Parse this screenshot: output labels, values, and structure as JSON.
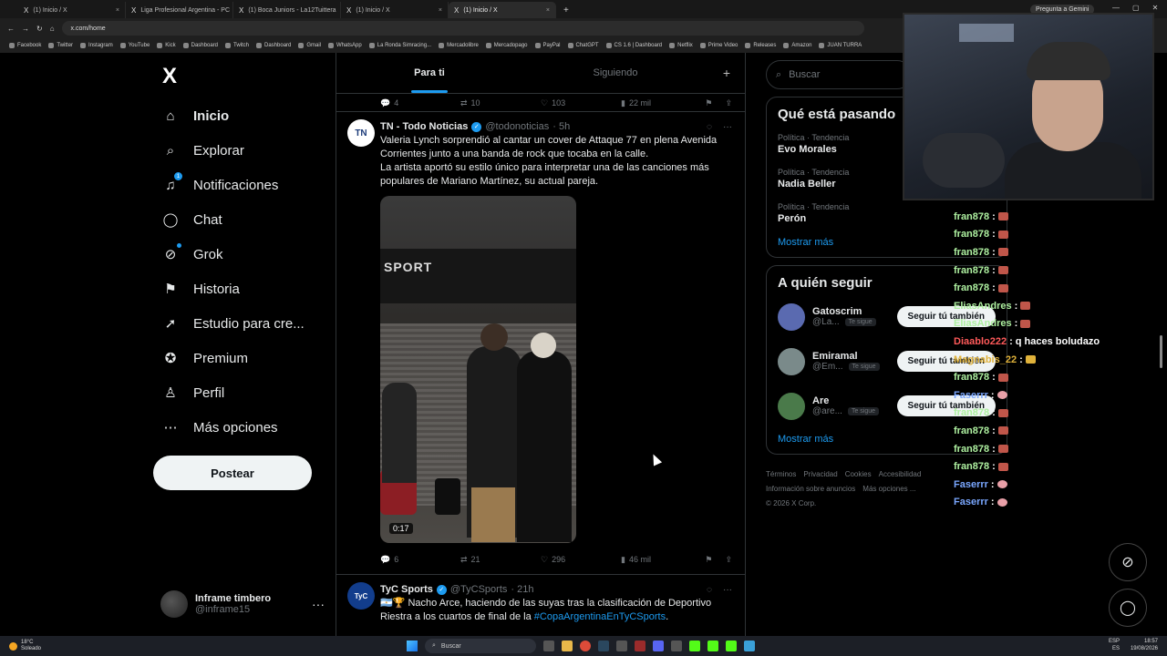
{
  "browser": {
    "tabs": [
      {
        "label": "(1) Inicio / X",
        "icon": "x-icon",
        "active": false
      },
      {
        "label": "Liga Profesional Argentina - PC",
        "icon": "leaf-icon",
        "active": false
      },
      {
        "label": "(1) Boca Juniors - La12Tuittera",
        "icon": "x-icon",
        "active": false
      },
      {
        "label": "(1) Inicio / X",
        "icon": "x-icon",
        "active": false
      },
      {
        "label": "(1) Inicio / X",
        "icon": "x-icon",
        "active": true
      }
    ],
    "new_tab": "+",
    "gemini_label": "Pregunta a Gemini",
    "url": "x.com/home",
    "bookmarks": [
      "Facebook",
      "Twitter",
      "Instagram",
      "YouTube",
      "Kick",
      "Dashboard",
      "Twitch",
      "Dashboard",
      "Gmail",
      "WhatsApp",
      "La Ronda Simracing...",
      "Mercadolibre",
      "Mercadopago",
      "PayPal",
      "ChatGPT",
      "CS 1.6 | Dashboard",
      "Netflix",
      "Prime Video",
      "Releases",
      "Amazon",
      "JUAN TURRA"
    ]
  },
  "nav": {
    "logo": "X",
    "items": [
      {
        "label": "Inicio",
        "icon": "home-icon",
        "active": true
      },
      {
        "label": "Explorar",
        "icon": "search-icon"
      },
      {
        "label": "Notificaciones",
        "icon": "bell-icon",
        "badge": "1"
      },
      {
        "label": "Chat",
        "icon": "chat-icon"
      },
      {
        "label": "Grok",
        "icon": "grok-icon"
      },
      {
        "label": "Historia",
        "icon": "bookmark-icon"
      },
      {
        "label": "Estudio para cre...",
        "icon": "rocket-icon"
      },
      {
        "label": "Premium",
        "icon": "verified-icon"
      },
      {
        "label": "Perfil",
        "icon": "person-icon"
      },
      {
        "label": "Más opciones",
        "icon": "more-icon"
      }
    ],
    "post_button": "Postear",
    "account": {
      "name": "Inframe timbero",
      "handle": "@inframe15",
      "more": "···"
    }
  },
  "feed": {
    "tabs": [
      "Para ti",
      "Siguiendo"
    ],
    "add": "+",
    "prev_actions": {
      "replies": "4",
      "reposts": "10",
      "likes": "103",
      "views": "22 mil"
    },
    "tweet1": {
      "avatar_text": "TN",
      "name": "TN - Todo Noticias",
      "handle": "@todonoticias",
      "time": "· 5h",
      "text1": "Valeria Lynch sorprendió al cantar un cover de Attaque 77 en plena Avenida Corrientes junto a una banda de rock que tocaba en la calle.",
      "text2": "La artista aportó su estilo único para interpretar una de las canciones más populares de Mariano Martínez, su actual pareja.",
      "video_sign": "SPORT",
      "duration": "0:17",
      "actions": {
        "replies": "6",
        "reposts": "21",
        "likes": "296",
        "views": "46 mil"
      }
    },
    "tweet2": {
      "avatar_text": "TyC",
      "name": "TyC Sports",
      "handle": "@TyCSports",
      "time": "· 21h",
      "text": "🇦🇷🏆 Nacho Arce, haciendo de las suyas tras la clasificación de Deportivo Riestra a los cuartos de final de la",
      "hashtag": "#CopaArgentinaEnTyCSports",
      "tail": "."
    }
  },
  "sidebar": {
    "search_placeholder": "Buscar",
    "trends_title": "Qué está pasando",
    "trends": [
      {
        "category": "Política · Tendencia",
        "name": "Evo Morales"
      },
      {
        "category": "Política · Tendencia",
        "name": "Nadia Beller"
      },
      {
        "category": "Política · Tendencia",
        "name": "Perón"
      }
    ],
    "show_more": "Mostrar más",
    "follow_title": "A quién seguir",
    "follow": [
      {
        "name": "Gatoscrim",
        "handle": "@La...",
        "tag": "Te sigue",
        "button": "Seguir tú también"
      },
      {
        "name": "Emiramal",
        "handle": "@Em...",
        "tag": "Te sigue",
        "button": "Seguir tú también"
      },
      {
        "name": "Are",
        "handle": "@are...",
        "tag": "Te sigue",
        "button": "Seguir tú también"
      }
    ],
    "show_more2": "Mostrar más",
    "footer": [
      "Términos",
      "Privacidad",
      "Cookies",
      "Accesibilidad",
      "Información sobre anuncios",
      "Más opciones ...",
      "© 2026 X Corp."
    ]
  },
  "chat": [
    {
      "user": "fran878",
      "msg": "",
      "emote": "r"
    },
    {
      "user": "fran878",
      "msg": "",
      "emote": "r"
    },
    {
      "user": "fran878",
      "msg": "",
      "emote": "r"
    },
    {
      "user": "fran878",
      "msg": "",
      "emote": "r"
    },
    {
      "user": "fran878",
      "msg": "",
      "emote": "r"
    },
    {
      "user": "EliasAndres",
      "msg": "",
      "emote": "r",
      "color": "#aef0a0"
    },
    {
      "user": "EliasAndres",
      "msg": "",
      "emote": "r",
      "color": "#aef0a0"
    },
    {
      "user": "Diaablo222",
      "msg": "q haces boludazo",
      "emote": "",
      "color": "#ff5a5a"
    },
    {
      "user": "Magnabis_22",
      "msg": "",
      "emote": "y",
      "color": "#e0b23a"
    },
    {
      "user": "fran878",
      "msg": "",
      "emote": "r"
    },
    {
      "user": "Faserrr",
      "msg": "",
      "emote": "p",
      "color": "#7aa7ff"
    },
    {
      "user": "fran878",
      "msg": "",
      "emote": "r"
    },
    {
      "user": "fran878",
      "msg": "",
      "emote": "r"
    },
    {
      "user": "fran878",
      "msg": "",
      "emote": "r"
    },
    {
      "user": "fran878",
      "msg": "",
      "emote": "r"
    },
    {
      "user": "Faserrr",
      "msg": "",
      "emote": "p",
      "color": "#7aa7ff"
    },
    {
      "user": "Faserrr",
      "msg": "",
      "emote": "p",
      "color": "#7aa7ff"
    }
  ],
  "taskbar": {
    "weather_temp": "18°C",
    "weather_desc": "Soleado",
    "search": "Buscar",
    "lang1": "ESP",
    "lang2": "ES",
    "time": "18:57",
    "date": "19/08/2026"
  }
}
